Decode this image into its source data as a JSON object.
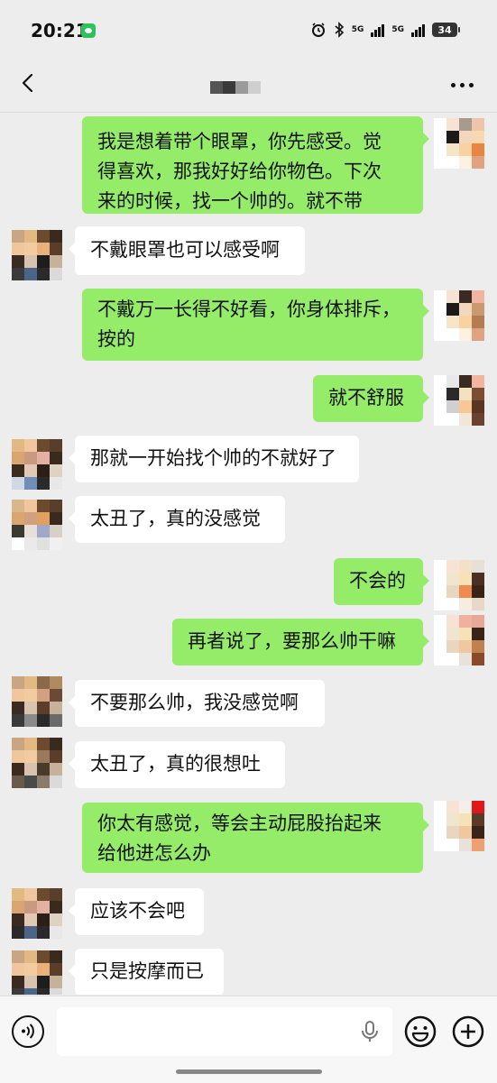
{
  "status_bar": {
    "time": "20:21",
    "battery": "34",
    "network_label_1": "5G",
    "network_label_2": "5G"
  },
  "header": {
    "title_redacted": true
  },
  "messages": [
    {
      "side": "out",
      "lines": [
        "我是想着带个眼罩，你先感受。觉",
        "得喜欢，那我好好给你物色。下次",
        "来的时候，找一个帅的。就不带"
      ]
    },
    {
      "side": "in",
      "lines": [
        "不戴眼罩也可以感受啊"
      ]
    },
    {
      "side": "out",
      "lines": [
        "不戴万一长得不好看，你身体排斥，",
        "按的"
      ]
    },
    {
      "side": "out",
      "lines": [
        "就不舒服"
      ]
    },
    {
      "side": "in",
      "lines": [
        "那就一开始找个帅的不就好了"
      ]
    },
    {
      "side": "in",
      "lines": [
        "太丑了，真的没感觉"
      ]
    },
    {
      "side": "out",
      "lines": [
        "不会的"
      ]
    },
    {
      "side": "out",
      "lines": [
        "再者说了，要那么帅干嘛"
      ]
    },
    {
      "side": "in",
      "lines": [
        "不要那么帅，我没感觉啊"
      ]
    },
    {
      "side": "in",
      "lines": [
        "太丑了，真的很想吐"
      ]
    },
    {
      "side": "out",
      "lines": [
        "你太有感觉，等会主动屁股抬起来",
        "给他进怎么办"
      ]
    },
    {
      "side": "in",
      "lines": [
        "应该不会吧"
      ]
    },
    {
      "side": "in",
      "lines": [
        "只是按摩而已"
      ]
    }
  ],
  "input_bar": {
    "placeholder": ""
  },
  "icons": {
    "back": "back-icon",
    "more": "more-icon",
    "voice": "voice-icon",
    "mic": "microphone-icon",
    "emoji": "emoji-icon",
    "plus": "plus-icon"
  },
  "colors": {
    "background": "#ededed",
    "outgoing_bubble": "#95ec69",
    "incoming_bubble": "#ffffff"
  }
}
